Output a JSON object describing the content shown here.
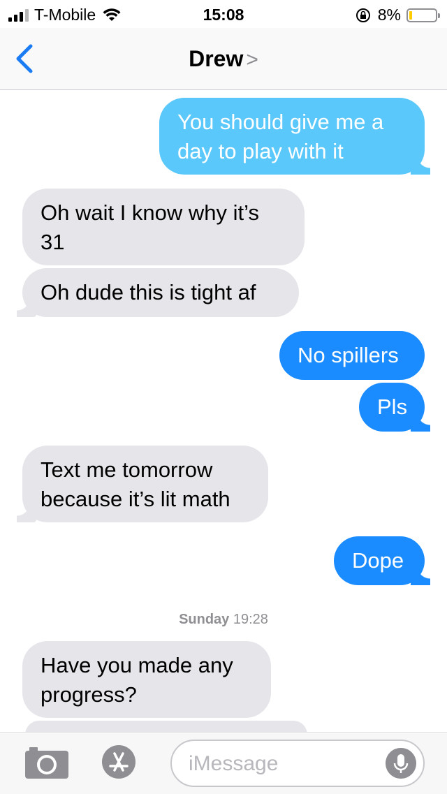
{
  "status_bar": {
    "carrier": "T-Mobile",
    "time": "15:08",
    "battery": "8%",
    "battery_color": "#ffcc00"
  },
  "nav": {
    "contact_name": "Drew",
    "back_icon": "chevron-left-icon",
    "accent_color": "#1a7cf5"
  },
  "messages": [
    {
      "direction": "out",
      "text": "You should give me a day to play with it"
    },
    {
      "direction": "in",
      "text": "Oh wait I know why it’s 31"
    },
    {
      "direction": "in",
      "text": "Oh dude this is tight af"
    },
    {
      "direction": "out",
      "text": "No spillers"
    },
    {
      "direction": "out",
      "text": "Pls"
    },
    {
      "direction": "in",
      "text": "Text me tomorrow because it’s lit math"
    },
    {
      "direction": "out",
      "text": "Dope"
    },
    {
      "direction": "in",
      "text": "Have you made any progress?"
    }
  ],
  "timestamp": {
    "day": "Sunday",
    "time": "19:28"
  },
  "compose": {
    "placeholder": "iMessage",
    "camera_icon": "camera-icon",
    "apps_icon": "app-store-icon",
    "mic_icon": "microphone-icon"
  },
  "colors": {
    "incoming_bubble": "#e5e5ea",
    "outgoing_bubble": "#1a8cff"
  }
}
